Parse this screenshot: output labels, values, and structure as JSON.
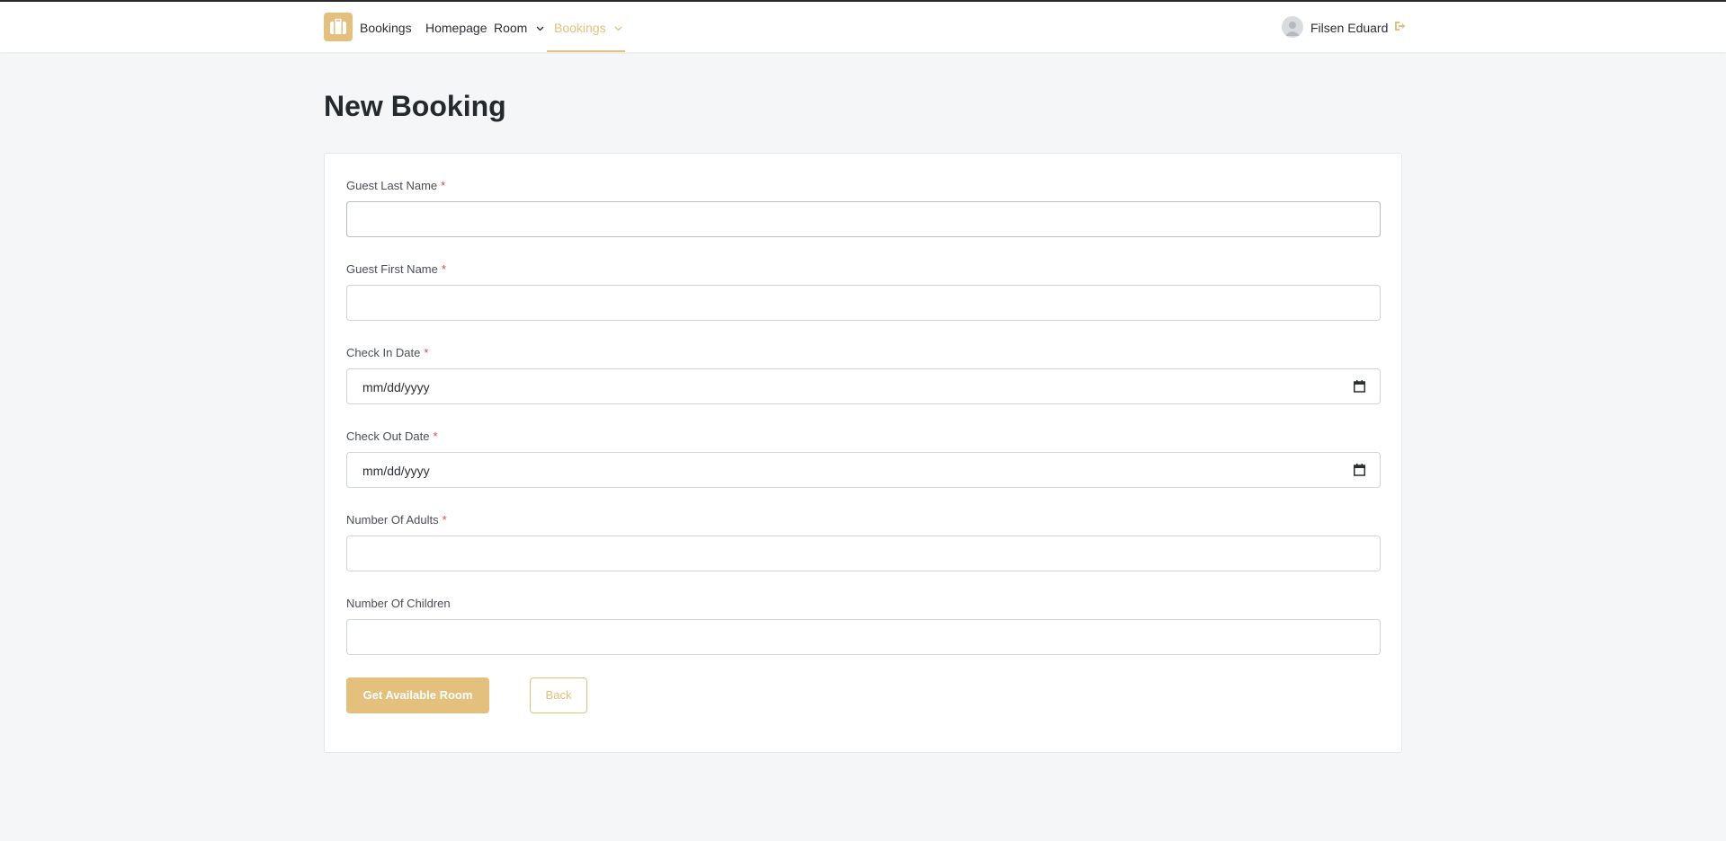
{
  "brand": {
    "name": "Bookings",
    "accent": "#e3c07e"
  },
  "nav": {
    "items": [
      {
        "label": "Homepage",
        "has_dropdown": false,
        "active": false
      },
      {
        "label": "Room",
        "has_dropdown": true,
        "active": false
      },
      {
        "label": "Bookings",
        "has_dropdown": true,
        "active": true
      }
    ]
  },
  "user": {
    "name": "Filsen Eduard",
    "avatar_icon": "user-avatar-icon",
    "logout_icon": "logout-icon"
  },
  "page": {
    "title": "New Booking"
  },
  "form": {
    "required_marker": "*",
    "fields": [
      {
        "label": "Guest Last Name",
        "required": true,
        "type": "text",
        "value": ""
      },
      {
        "label": "Guest First Name",
        "required": true,
        "type": "text",
        "value": ""
      },
      {
        "label": "Check In Date",
        "required": true,
        "type": "date",
        "value": "mm/dd/yyyy"
      },
      {
        "label": "Check Out Date",
        "required": true,
        "type": "date",
        "value": "mm/dd/yyyy"
      },
      {
        "label": "Number Of Adults",
        "required": true,
        "type": "text",
        "value": ""
      },
      {
        "label": "Number Of Children",
        "required": false,
        "type": "text",
        "value": ""
      }
    ],
    "submit_label": "Get Available Room",
    "back_label": "Back"
  }
}
